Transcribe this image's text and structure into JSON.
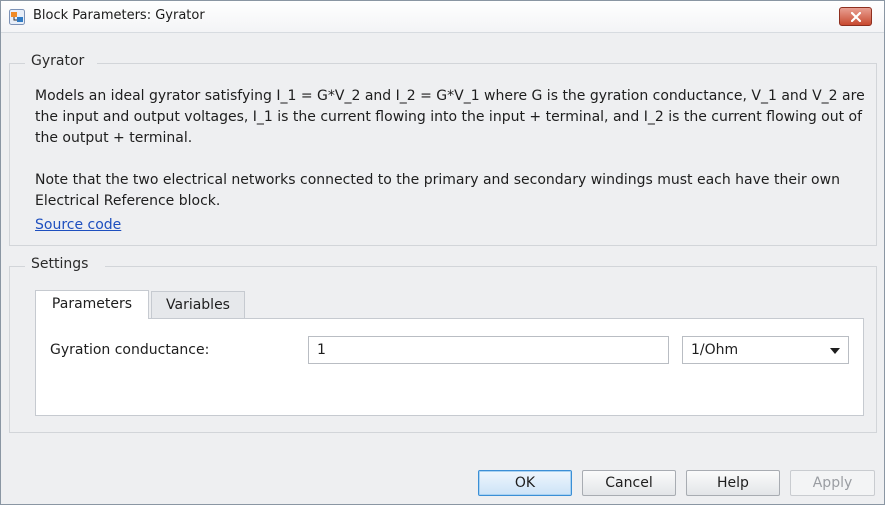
{
  "window": {
    "title": "Block Parameters: Gyrator",
    "app_icon": "simulink-block-icon",
    "close_icon": "close-icon"
  },
  "block_group": {
    "title": "Gyrator",
    "description_1": "Models an ideal gyrator satisfying I_1 = G*V_2 and I_2 = G*V_1 where G is the gyration conductance, V_1 and V_2 are the input and output voltages, I_1 is the current flowing into the input + terminal, and I_2 is the current flowing out of the output + terminal.",
    "description_2": "Note that the two electrical networks connected to the primary and secondary windings must each have their own Electrical Reference block.",
    "source_link": "Source code"
  },
  "settings_group": {
    "title": "Settings",
    "tabs": [
      {
        "label": "Parameters",
        "active": true
      },
      {
        "label": "Variables",
        "active": false
      }
    ],
    "params": [
      {
        "label": "Gyration conductance:",
        "value": "1",
        "unit": "1/Ohm"
      }
    ]
  },
  "buttons": {
    "ok": "OK",
    "cancel": "Cancel",
    "help": "Help",
    "apply": "Apply"
  },
  "colors": {
    "link": "#1e4fbf",
    "close_button": "#c84a30",
    "default_button_border": "#3b8fd6"
  }
}
